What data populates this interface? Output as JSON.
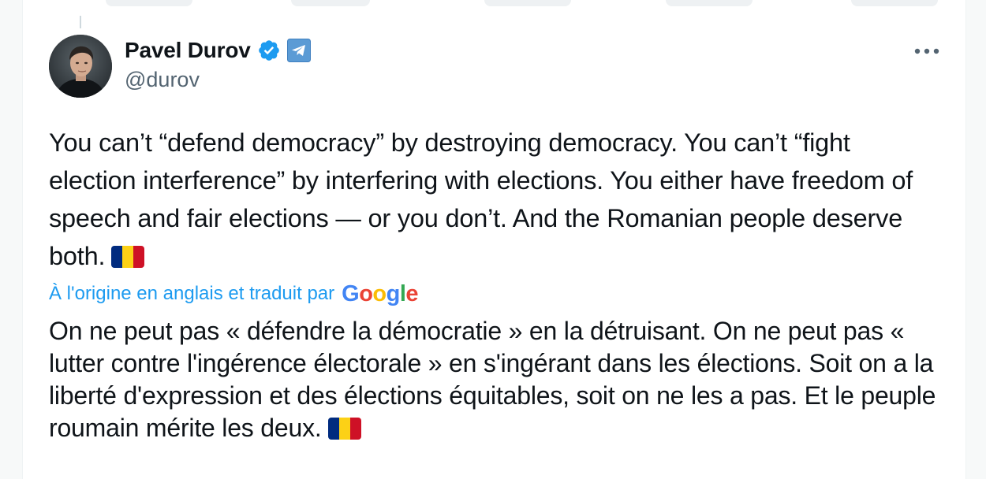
{
  "author": {
    "name": "Pavel Durov",
    "handle": "@durov",
    "verified_icon": "verified-badge-icon",
    "affiliate_icon": "telegram-icon"
  },
  "menu": {
    "more_icon": "more-horizontal-icon"
  },
  "tweet": {
    "text": "You can’t “defend democracy” by destroying democracy. You can’t “fight election interference” by interfering with elections. You either have freedom of speech and fair elections — or you don’t. And the Romanian people deserve both.",
    "flag_icon": "romania-flag-icon"
  },
  "translation": {
    "label": "À l'origine en anglais et traduit par",
    "provider": "Google",
    "text": "On ne peut pas « défendre la démocratie » en la détruisant. On ne peut pas « lutter contre l'ingérence électorale » en s'ingérant dans les élections. Soit on a la liberté d'expression et des élections équitables, soit on ne les a pas. Et le peuple roumain mérite les deux."
  },
  "colors": {
    "text": "#0f1419",
    "secondary": "#536471",
    "link": "#1d9bf0",
    "verified": "#1d9bf0",
    "telegram": "#5b9bd5",
    "flag_blue": "#002b7f",
    "flag_yellow": "#fcd116",
    "flag_red": "#ce1126"
  }
}
